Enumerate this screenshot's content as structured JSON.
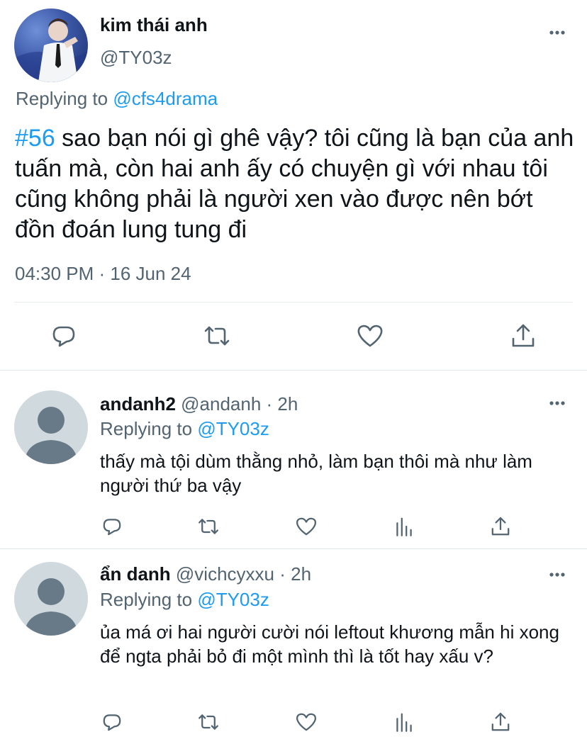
{
  "main_tweet": {
    "author_name": "kim thái anh",
    "author_handle": "@TY03z",
    "replying_prefix": "Replying to",
    "replying_to": "@cfs4drama",
    "hashtag": "#56",
    "text": " sao bạn nói gì ghê vậy? tôi cũng là bạn của anh tuấn mà, còn hai anh ấy có chuyện gì với nhau tôi cũng không phải là người xen vào được nên bớt đồn đoán lung tung đi",
    "timestamp": "04:30 PM · 16 Jun 24",
    "actions": [
      "reply-icon",
      "retweet-icon",
      "like-icon",
      "share-icon"
    ]
  },
  "replies": [
    {
      "name": "andanh2",
      "handle": "@andanh",
      "time": "· 2h",
      "replying_prefix": "Replying to",
      "replying_to": "@TY03z",
      "text": "thấy mà tội dùm thằng nhỏ, làm bạn thôi mà như làm người thứ ba vậy",
      "actions": [
        "reply-icon",
        "retweet-icon",
        "like-icon",
        "analytics-icon",
        "share-icon"
      ]
    },
    {
      "name": "ẩn danh",
      "handle": "@vichcyxxu",
      "time": "· 2h",
      "replying_prefix": "Replying to",
      "replying_to": "@TY03z",
      "text": "ủa má ơi hai người cười nói leftout khương mẫn hi xong để ngta phải bỏ đi một mình thì là tốt hay xấu v?",
      "actions": [
        "reply-icon",
        "retweet-icon",
        "like-icon",
        "analytics-icon",
        "share-icon"
      ]
    }
  ],
  "colors": {
    "link": "#1d9bf0",
    "secondary_text": "#536471",
    "primary_text": "#0f1419",
    "divider": "#e1e8ed",
    "default_avatar_bg": "#cfd9de",
    "default_avatar_fg": "#687987"
  }
}
